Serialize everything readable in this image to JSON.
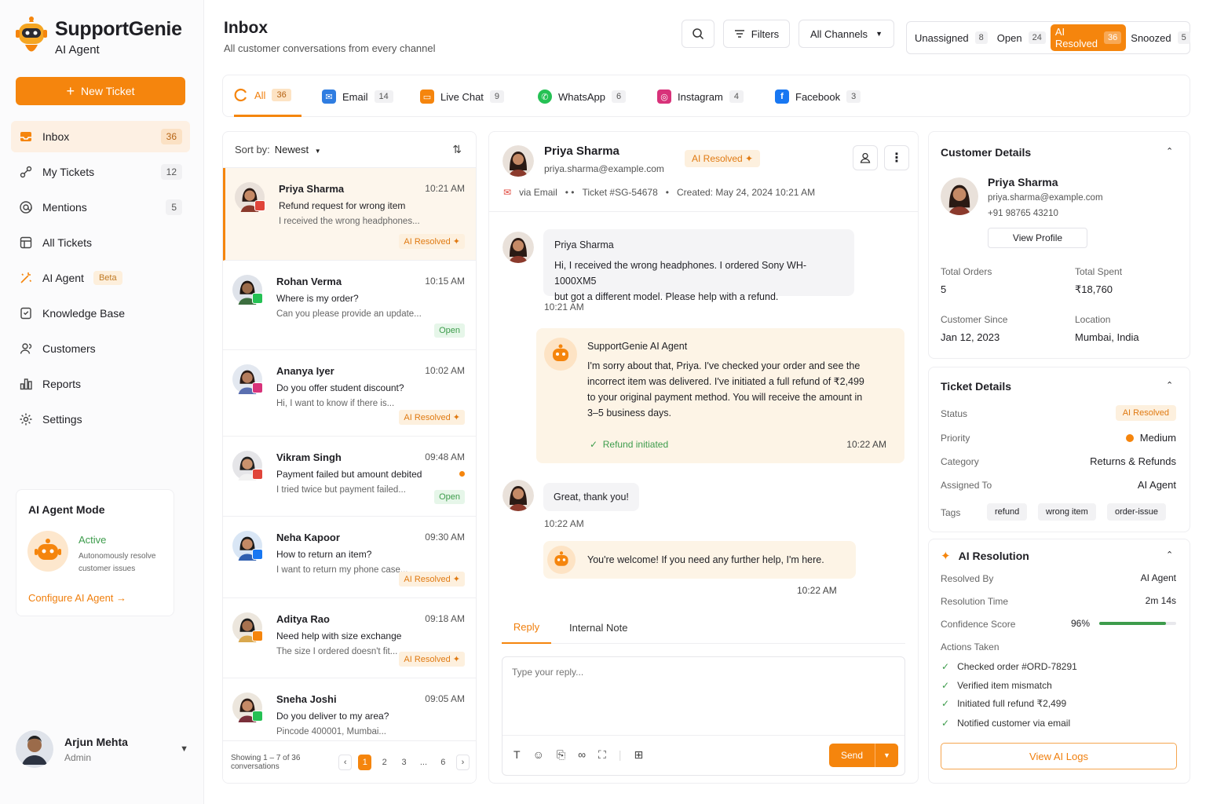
{
  "brand": {
    "name": "SupportGenie",
    "sub": "AI Agent"
  },
  "new_ticket": "New Ticket",
  "nav": [
    {
      "label": "Inbox",
      "count": "36",
      "icon": "inbox-icon"
    },
    {
      "label": "My Tickets",
      "count": "12",
      "icon": "tickets-icon"
    },
    {
      "label": "Mentions",
      "count": "5",
      "icon": "at-icon"
    },
    {
      "label": "All Tickets",
      "count": "",
      "icon": "list-icon"
    },
    {
      "label": "AI Agent",
      "badge": "Beta",
      "icon": "sparkle-icon"
    },
    {
      "label": "Knowledge Base",
      "icon": "book-icon"
    },
    {
      "label": "Customers",
      "icon": "users-icon"
    },
    {
      "label": "Reports",
      "icon": "chart-icon"
    },
    {
      "label": "Settings",
      "icon": "gear-icon"
    }
  ],
  "agent_mode": {
    "title": "AI Agent Mode",
    "status": "Active",
    "desc": "Autonomously resolve customer issues",
    "config": "Configure AI Agent"
  },
  "user": {
    "name": "Arjun Mehta",
    "role": "Admin"
  },
  "header": {
    "title": "Inbox",
    "sub": "All customer conversations from every channel",
    "filters": "Filters",
    "channel_select": "All Channels"
  },
  "statuses": [
    {
      "label": "Unassigned",
      "count": "8"
    },
    {
      "label": "Open",
      "count": "24"
    },
    {
      "label": "AI Resolved",
      "count": "36"
    },
    {
      "label": "Snoozed",
      "count": "5"
    }
  ],
  "channels": [
    {
      "label": "All",
      "count": "36",
      "color": "#f5850d"
    },
    {
      "label": "Email",
      "count": "14",
      "color": "#2f7de1"
    },
    {
      "label": "Live Chat",
      "count": "9",
      "color": "#f5850d"
    },
    {
      "label": "WhatsApp",
      "count": "6",
      "color": "#25c154"
    },
    {
      "label": "Instagram",
      "count": "4",
      "color": "#d8327a"
    },
    {
      "label": "Facebook",
      "count": "3",
      "color": "#1877f2"
    }
  ],
  "sort": {
    "label": "Sort by:",
    "value": "Newest"
  },
  "conversations": [
    {
      "name": "Priya Sharma",
      "time": "10:21 AM",
      "subject": "Refund request for wrong item",
      "preview": "I received the wrong headphones...",
      "status": "AI Resolved",
      "channel": "email"
    },
    {
      "name": "Rohan Verma",
      "time": "10:15 AM",
      "subject": "Where is my order?",
      "preview": "Can you please provide an update...",
      "status": "Open",
      "channel": "whatsapp"
    },
    {
      "name": "Ananya Iyer",
      "time": "10:02 AM",
      "subject": "Do you offer student discount?",
      "preview": "Hi, I want to know if there is...",
      "status": "AI Resolved",
      "channel": "instagram"
    },
    {
      "name": "Vikram Singh",
      "time": "09:48 AM",
      "subject": "Payment failed but amount debited",
      "preview": "I tried twice but payment failed...",
      "status": "Open",
      "channel": "email"
    },
    {
      "name": "Neha Kapoor",
      "time": "09:30 AM",
      "subject": "How to return an item?",
      "preview": "I want to return my phone case...",
      "status": "AI Resolved",
      "channel": "facebook"
    },
    {
      "name": "Aditya Rao",
      "time": "09:18 AM",
      "subject": "Need help with size exchange",
      "preview": "The size I ordered doesn't fit...",
      "status": "AI Resolved",
      "channel": "chat"
    },
    {
      "name": "Sneha Joshi",
      "time": "09:05 AM",
      "subject": "Do you deliver to my area?",
      "preview": "Pincode 400001, Mumbai...",
      "status": "",
      "channel": "whatsapp"
    }
  ],
  "pagination": {
    "showing": "Showing 1 – 7 of 36 conversations",
    "pages": [
      "1",
      "2",
      "3",
      "...",
      "6"
    ]
  },
  "chat": {
    "name": "Priya Sharma",
    "email": "priya.sharma@example.com",
    "status": "AI Resolved",
    "via": "via Email",
    "ticket": "Ticket #SG-54678",
    "created": "Created: May 24, 2024 10:21 AM",
    "messages": [
      {
        "from": "Priya Sharma",
        "text1": "Hi, I received the wrong headphones. I ordered Sony WH-1000XM5",
        "text2": "but got a different model. Please help with a refund.",
        "time": "10:21 AM"
      },
      {
        "from": "SupportGenie AI Agent",
        "lines": [
          "I'm sorry about that, Priya. I've checked your order and see the",
          "incorrect item was delivered. I've initiated a full refund of ₹2,499",
          "to your original payment method. You will receive the amount in",
          "3–5 business days."
        ],
        "action": "Refund initiated",
        "time": "10:22 AM"
      },
      {
        "text": "Great, thank you!",
        "time": "10:22 AM"
      },
      {
        "text": "You're welcome! If you need any further help, I'm here.",
        "time": "10:22 AM"
      }
    ],
    "tabs": [
      "Reply",
      "Internal Note"
    ],
    "placeholder": "Type your reply...",
    "send": "Send"
  },
  "customer": {
    "title": "Customer Details",
    "name": "Priya Sharma",
    "email": "priya.sharma@example.com",
    "phone": "+91 98765 43210",
    "view": "View Profile",
    "orders_lbl": "Total Orders",
    "orders": "5",
    "spent_lbl": "Total Spent",
    "spent": "₹18,760",
    "since_lbl": "Customer Since",
    "since": "Jan 12, 2023",
    "loc_lbl": "Location",
    "loc": "Mumbai, India"
  },
  "ticket": {
    "title": "Ticket Details",
    "status_lbl": "Status",
    "status": "AI Resolved",
    "priority_lbl": "Priority",
    "priority": "Medium",
    "category_lbl": "Category",
    "category": "Returns & Refunds",
    "assigned_lbl": "Assigned To",
    "assigned": "AI Agent",
    "tags_lbl": "Tags",
    "tags": [
      "refund",
      "wrong item",
      "order-issue"
    ]
  },
  "resolution": {
    "title": "AI Resolution",
    "by_lbl": "Resolved By",
    "by": "AI Agent",
    "time_lbl": "Resolution Time",
    "time": "2m 14s",
    "conf_lbl": "Confidence Score",
    "conf": "96%",
    "conf_value": 0.96,
    "actions_lbl": "Actions Taken",
    "actions": [
      "Checked order #ORD-78291",
      "Verified item mismatch",
      "Initiated full refund ₹2,499",
      "Notified customer via email"
    ],
    "logs": "View AI Logs"
  }
}
